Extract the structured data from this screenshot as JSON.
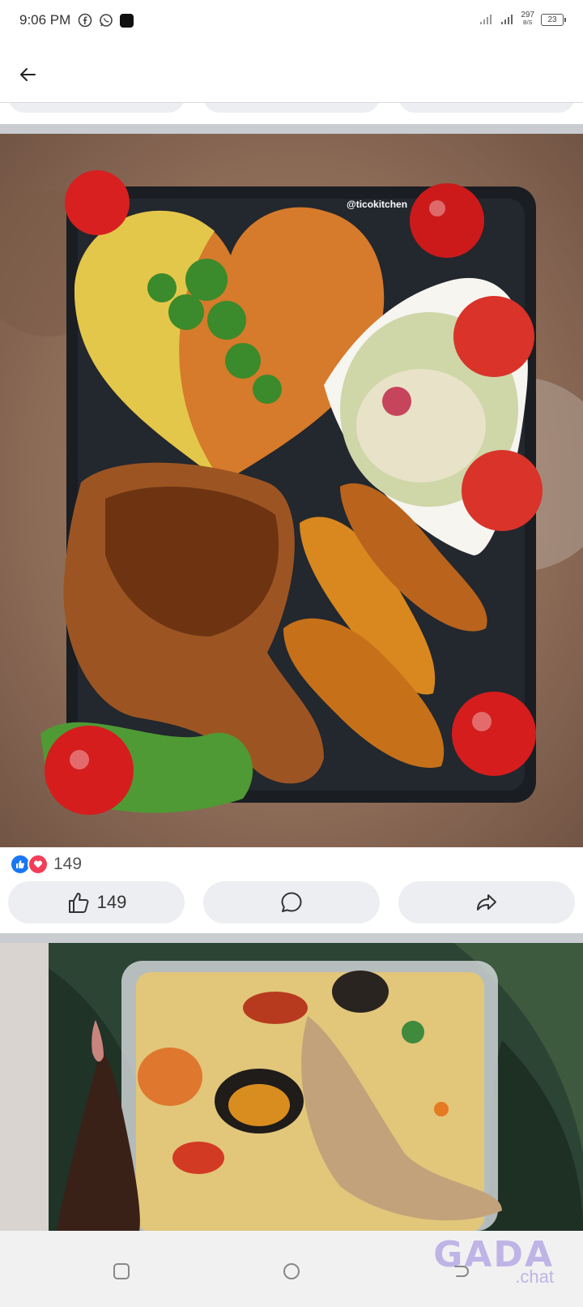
{
  "status_bar": {
    "time": "9:06 PM",
    "net_speed_value": "297",
    "net_speed_unit": "B/S",
    "battery": "23"
  },
  "post1": {
    "watermark": "@ticokitchen",
    "reaction_count": "149",
    "actions": {
      "like_count": "149"
    }
  },
  "overlay": {
    "brand": "GADA",
    "brand_suffix": ".chat"
  },
  "colors": {
    "facebook_blue": "#1877f2",
    "love_red": "#f33e58"
  },
  "icons": [
    "back-arrow-icon",
    "facebook-icon",
    "whatsapp-icon",
    "app-icon",
    "signal-icon",
    "battery-icon",
    "like-icon",
    "love-icon",
    "thumbs-up-icon",
    "comment-icon",
    "share-icon",
    "recents-icon",
    "home-icon",
    "back-icon"
  ]
}
